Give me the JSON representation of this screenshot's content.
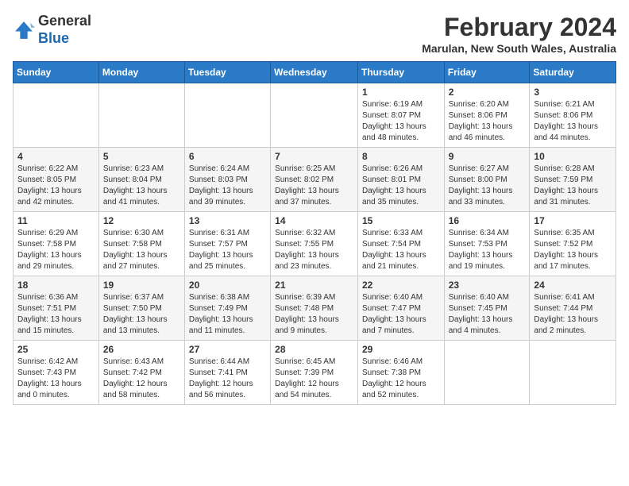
{
  "header": {
    "logo_general": "General",
    "logo_blue": "Blue",
    "month_year": "February 2024",
    "location": "Marulan, New South Wales, Australia"
  },
  "days_of_week": [
    "Sunday",
    "Monday",
    "Tuesday",
    "Wednesday",
    "Thursday",
    "Friday",
    "Saturday"
  ],
  "weeks": [
    [
      {
        "day": "",
        "info": ""
      },
      {
        "day": "",
        "info": ""
      },
      {
        "day": "",
        "info": ""
      },
      {
        "day": "",
        "info": ""
      },
      {
        "day": "1",
        "info": "Sunrise: 6:19 AM\nSunset: 8:07 PM\nDaylight: 13 hours\nand 48 minutes."
      },
      {
        "day": "2",
        "info": "Sunrise: 6:20 AM\nSunset: 8:06 PM\nDaylight: 13 hours\nand 46 minutes."
      },
      {
        "day": "3",
        "info": "Sunrise: 6:21 AM\nSunset: 8:06 PM\nDaylight: 13 hours\nand 44 minutes."
      }
    ],
    [
      {
        "day": "4",
        "info": "Sunrise: 6:22 AM\nSunset: 8:05 PM\nDaylight: 13 hours\nand 42 minutes."
      },
      {
        "day": "5",
        "info": "Sunrise: 6:23 AM\nSunset: 8:04 PM\nDaylight: 13 hours\nand 41 minutes."
      },
      {
        "day": "6",
        "info": "Sunrise: 6:24 AM\nSunset: 8:03 PM\nDaylight: 13 hours\nand 39 minutes."
      },
      {
        "day": "7",
        "info": "Sunrise: 6:25 AM\nSunset: 8:02 PM\nDaylight: 13 hours\nand 37 minutes."
      },
      {
        "day": "8",
        "info": "Sunrise: 6:26 AM\nSunset: 8:01 PM\nDaylight: 13 hours\nand 35 minutes."
      },
      {
        "day": "9",
        "info": "Sunrise: 6:27 AM\nSunset: 8:00 PM\nDaylight: 13 hours\nand 33 minutes."
      },
      {
        "day": "10",
        "info": "Sunrise: 6:28 AM\nSunset: 7:59 PM\nDaylight: 13 hours\nand 31 minutes."
      }
    ],
    [
      {
        "day": "11",
        "info": "Sunrise: 6:29 AM\nSunset: 7:58 PM\nDaylight: 13 hours\nand 29 minutes."
      },
      {
        "day": "12",
        "info": "Sunrise: 6:30 AM\nSunset: 7:58 PM\nDaylight: 13 hours\nand 27 minutes."
      },
      {
        "day": "13",
        "info": "Sunrise: 6:31 AM\nSunset: 7:57 PM\nDaylight: 13 hours\nand 25 minutes."
      },
      {
        "day": "14",
        "info": "Sunrise: 6:32 AM\nSunset: 7:55 PM\nDaylight: 13 hours\nand 23 minutes."
      },
      {
        "day": "15",
        "info": "Sunrise: 6:33 AM\nSunset: 7:54 PM\nDaylight: 13 hours\nand 21 minutes."
      },
      {
        "day": "16",
        "info": "Sunrise: 6:34 AM\nSunset: 7:53 PM\nDaylight: 13 hours\nand 19 minutes."
      },
      {
        "day": "17",
        "info": "Sunrise: 6:35 AM\nSunset: 7:52 PM\nDaylight: 13 hours\nand 17 minutes."
      }
    ],
    [
      {
        "day": "18",
        "info": "Sunrise: 6:36 AM\nSunset: 7:51 PM\nDaylight: 13 hours\nand 15 minutes."
      },
      {
        "day": "19",
        "info": "Sunrise: 6:37 AM\nSunset: 7:50 PM\nDaylight: 13 hours\nand 13 minutes."
      },
      {
        "day": "20",
        "info": "Sunrise: 6:38 AM\nSunset: 7:49 PM\nDaylight: 13 hours\nand 11 minutes."
      },
      {
        "day": "21",
        "info": "Sunrise: 6:39 AM\nSunset: 7:48 PM\nDaylight: 13 hours\nand 9 minutes."
      },
      {
        "day": "22",
        "info": "Sunrise: 6:40 AM\nSunset: 7:47 PM\nDaylight: 13 hours\nand 7 minutes."
      },
      {
        "day": "23",
        "info": "Sunrise: 6:40 AM\nSunset: 7:45 PM\nDaylight: 13 hours\nand 4 minutes."
      },
      {
        "day": "24",
        "info": "Sunrise: 6:41 AM\nSunset: 7:44 PM\nDaylight: 13 hours\nand 2 minutes."
      }
    ],
    [
      {
        "day": "25",
        "info": "Sunrise: 6:42 AM\nSunset: 7:43 PM\nDaylight: 13 hours\nand 0 minutes."
      },
      {
        "day": "26",
        "info": "Sunrise: 6:43 AM\nSunset: 7:42 PM\nDaylight: 12 hours\nand 58 minutes."
      },
      {
        "day": "27",
        "info": "Sunrise: 6:44 AM\nSunset: 7:41 PM\nDaylight: 12 hours\nand 56 minutes."
      },
      {
        "day": "28",
        "info": "Sunrise: 6:45 AM\nSunset: 7:39 PM\nDaylight: 12 hours\nand 54 minutes."
      },
      {
        "day": "29",
        "info": "Sunrise: 6:46 AM\nSunset: 7:38 PM\nDaylight: 12 hours\nand 52 minutes."
      },
      {
        "day": "",
        "info": ""
      },
      {
        "day": "",
        "info": ""
      }
    ]
  ]
}
